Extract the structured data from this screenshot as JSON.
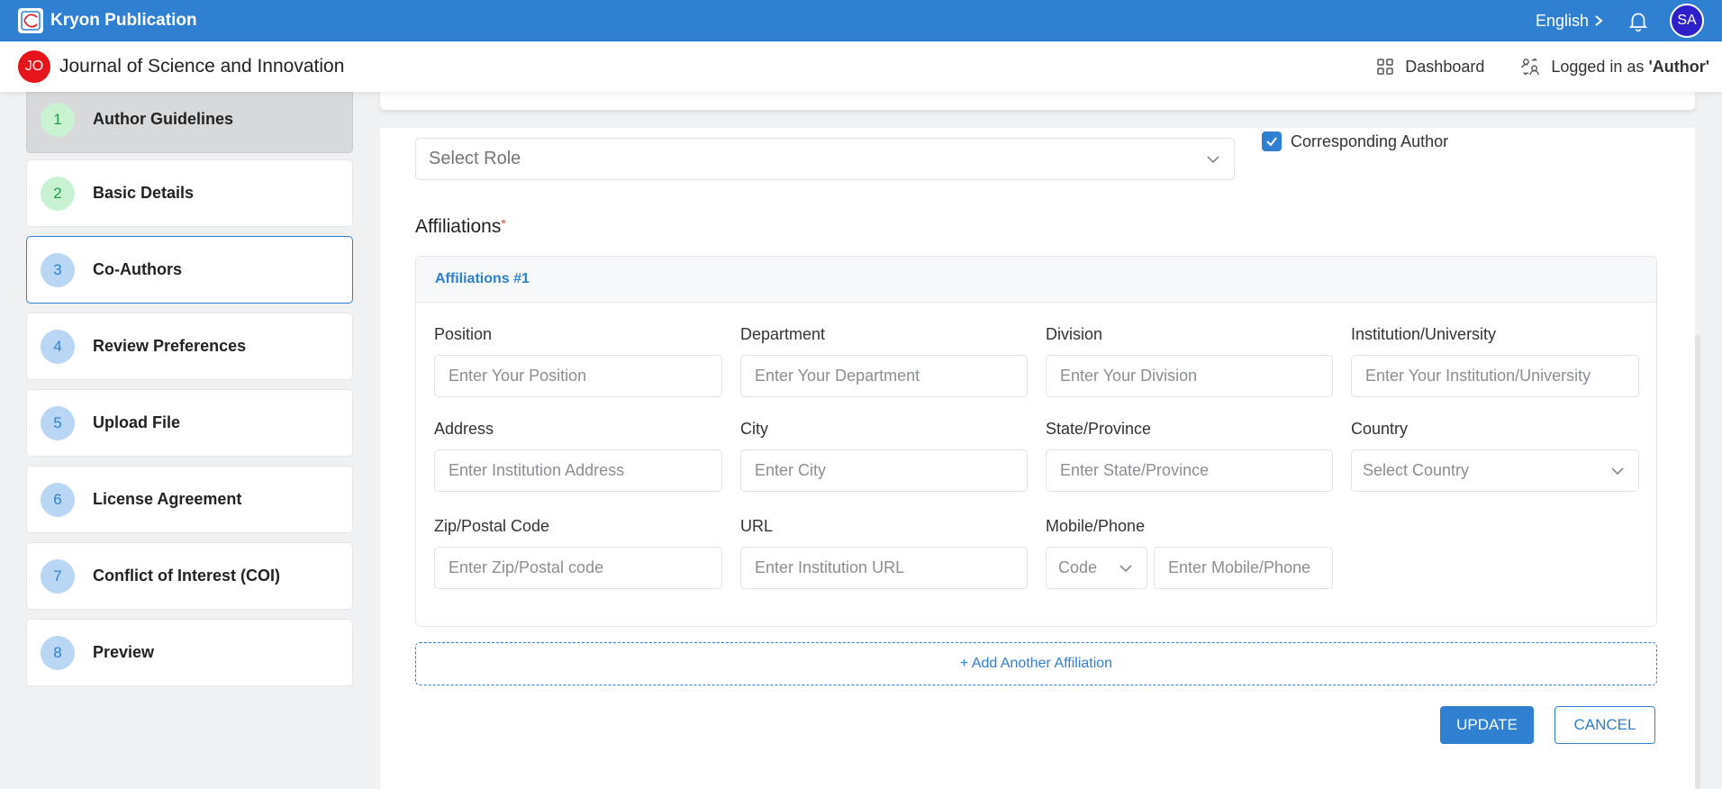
{
  "app": {
    "brand": "Kryon Publication",
    "language": "English",
    "user_initials": "SA"
  },
  "journal": {
    "badge": "JO",
    "title": "Journal of Science and Innovation"
  },
  "header": {
    "dashboard_label": "Dashboard",
    "logged_in_prefix": "Logged in as ",
    "logged_in_role": "'Author'"
  },
  "steps": [
    {
      "num": "1",
      "label": "Author Guidelines"
    },
    {
      "num": "2",
      "label": "Basic Details"
    },
    {
      "num": "3",
      "label": "Co-Authors"
    },
    {
      "num": "4",
      "label": "Review Preferences"
    },
    {
      "num": "5",
      "label": "Upload File"
    },
    {
      "num": "6",
      "label": "License Agreement"
    },
    {
      "num": "7",
      "label": "Conflict of Interest (COI)"
    },
    {
      "num": "8",
      "label": "Preview"
    }
  ],
  "form": {
    "role_placeholder": "Select Role",
    "corresponding_author_label": "Corresponding Author",
    "corresponding_author_checked": true,
    "affiliations_heading": "Affiliations",
    "required_mark": "*",
    "affiliation_title": "Affiliations #1",
    "fields": {
      "position": {
        "label": "Position",
        "placeholder": "Enter Your Position"
      },
      "department": {
        "label": "Department",
        "placeholder": "Enter Your Department"
      },
      "division": {
        "label": "Division",
        "placeholder": "Enter Your Division"
      },
      "institution": {
        "label": "Institution/University",
        "placeholder": "Enter Your Institution/University"
      },
      "address": {
        "label": "Address",
        "placeholder": "Enter Institution Address"
      },
      "city": {
        "label": "City",
        "placeholder": "Enter City"
      },
      "state": {
        "label": "State/Province",
        "placeholder": "Enter State/Province"
      },
      "country": {
        "label": "Country",
        "placeholder": "Select Country"
      },
      "zip": {
        "label": "Zip/Postal Code",
        "placeholder": "Enter Zip/Postal code"
      },
      "url": {
        "label": "URL",
        "placeholder": "Enter Institution URL"
      },
      "phone": {
        "label": "Mobile/Phone",
        "code_placeholder": "Code",
        "placeholder": "Enter Mobile/Phone"
      }
    },
    "add_affiliation": "+ Add Another Affiliation",
    "update_button": "UPDATE",
    "cancel_button": "CANCEL"
  },
  "colors": {
    "primary": "#2f80d1",
    "badge_red": "#e6141b",
    "step_green": "#1e9e45"
  }
}
